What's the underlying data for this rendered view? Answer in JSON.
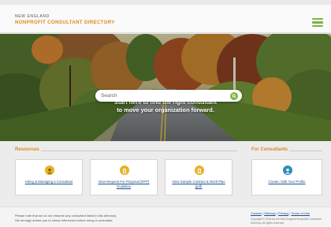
{
  "header": {
    "org_line": "NEW ENGLAND",
    "title": "NONPROFIT CONSULTANT DIRECTORY"
  },
  "hero": {
    "line1": "Start here to find the right consultant",
    "line2": "to move your organization forward."
  },
  "search": {
    "placeholder": "Search"
  },
  "resources": {
    "title": "Resources",
    "cards": [
      {
        "label": "Hiring & Managing a Consultant",
        "icon": "person-icon"
      },
      {
        "label": "View Request For Proposal (RFP) Guideline",
        "icon": "document-icon"
      },
      {
        "label": "View Sample Contract & Work Plan (pdf)",
        "icon": "document-icon"
      }
    ]
  },
  "consultants": {
    "title": "For Consultants",
    "card": {
      "label": "Create / Edit Your Profile",
      "icon": "profile-icon"
    }
  },
  "footer": {
    "note_line1": "Please note that we do not endorse any consultant listed in this directory.",
    "note_line2": "We strongly advise you to check references before hiring a consultant.",
    "links": [
      "Contact",
      "Sitemap",
      "Privacy",
      "Terms of Use"
    ],
    "copyright": "Copyright © 2016 by the New England Nonprofit Consultant Directory. All rights reserved."
  },
  "colors": {
    "accent_green": "#7cb342",
    "accent_orange": "#d9862a",
    "link_blue": "#1f4e8c",
    "icon_gold": "#e9b21f",
    "icon_teal": "#2c8fb8"
  }
}
